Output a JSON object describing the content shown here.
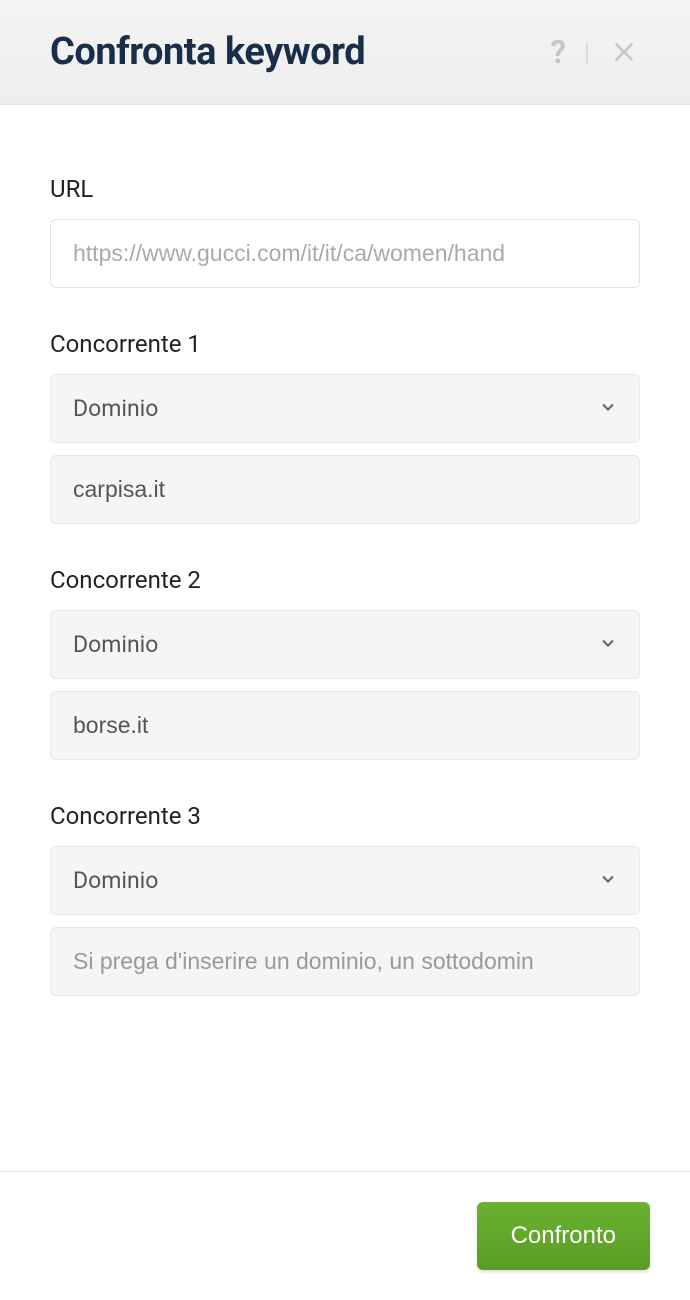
{
  "header": {
    "title": "Confronta keyword"
  },
  "form": {
    "url": {
      "label": "URL",
      "value": "",
      "placeholder": "https://www.gucci.com/it/it/ca/women/hand"
    },
    "competitors": [
      {
        "label": "Concorrente 1",
        "type_selected": "Dominio",
        "value": "carpisa.it",
        "placeholder": ""
      },
      {
        "label": "Concorrente 2",
        "type_selected": "Dominio",
        "value": "borse.it",
        "placeholder": ""
      },
      {
        "label": "Concorrente 3",
        "type_selected": "Dominio",
        "value": "",
        "placeholder": "Si prega d'inserire un dominio, un sottodomin"
      }
    ]
  },
  "footer": {
    "submit_label": "Confronto"
  }
}
